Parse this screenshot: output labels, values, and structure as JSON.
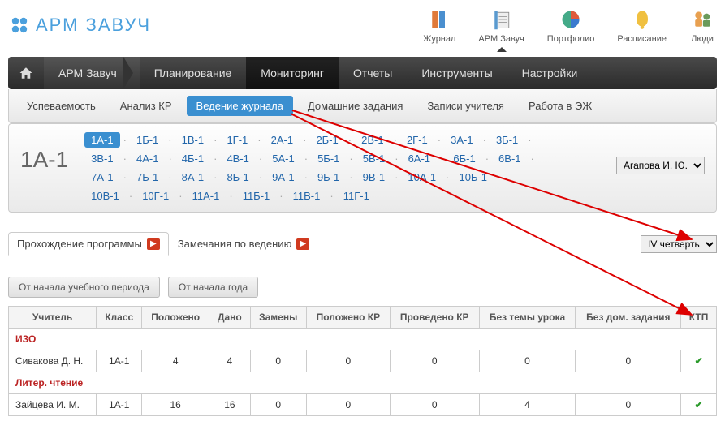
{
  "app": {
    "title": "АРМ ЗАВУЧ"
  },
  "topIcons": [
    {
      "label": "Журнал"
    },
    {
      "label": "АРМ Завуч",
      "active": true
    },
    {
      "label": "Портфолио"
    },
    {
      "label": "Расписание"
    },
    {
      "label": "Люди"
    }
  ],
  "mainNav": {
    "breadcrumb": "АРМ Завуч",
    "items": [
      "Планирование",
      "Мониторинг",
      "Отчеты",
      "Инструменты",
      "Настройки"
    ],
    "active": "Мониторинг"
  },
  "subNav": {
    "items": [
      "Успеваемость",
      "Анализ КР",
      "Ведение журнала",
      "Домашние задания",
      "Записи учителя",
      "Работа в ЭЖ"
    ],
    "active": "Ведение журнала"
  },
  "classSelector": {
    "current": "1А-1",
    "classes": [
      "1А-1",
      "1Б-1",
      "1В-1",
      "1Г-1",
      "2А-1",
      "2Б-1",
      "2В-1",
      "2Г-1",
      "3А-1",
      "3Б-1",
      "3В-1",
      "4А-1",
      "4Б-1",
      "4В-1",
      "5А-1",
      "5Б-1",
      "5В-1",
      "6А-1",
      "6Б-1",
      "6В-1",
      "7А-1",
      "7Б-1",
      "8А-1",
      "8Б-1",
      "9А-1",
      "9Б-1",
      "9В-1",
      "10А-1",
      "10Б-1",
      "10В-1",
      "10Г-1",
      "11А-1",
      "11Б-1",
      "11В-1",
      "11Г-1"
    ],
    "teacher": "Агапова И. Ю."
  },
  "tabs": {
    "items": [
      "Прохождение программы",
      "Замечания по ведению"
    ],
    "active": "Прохождение программы",
    "quarter": "IV четверть"
  },
  "filters": {
    "items": [
      "От начала учебного периода",
      "От начала года"
    ]
  },
  "table": {
    "headers": [
      "Учитель",
      "Класс",
      "Положено",
      "Дано",
      "Замены",
      "Положено КР",
      "Проведено КР",
      "Без темы урока",
      "Без дом. задания",
      "КТП"
    ],
    "groups": [
      {
        "subject": "ИЗО",
        "rows": [
          {
            "cells": [
              "Сивакова Д. Н.",
              "1А-1",
              "4",
              "4",
              "0",
              "0",
              "0",
              "0",
              "0",
              "✓"
            ]
          }
        ]
      },
      {
        "subject": "Литер. чтение",
        "rows": [
          {
            "cells": [
              "Зайцева И. М.",
              "1А-1",
              "16",
              "16",
              "0",
              "0",
              "0",
              "4",
              "0",
              "✓"
            ]
          }
        ]
      }
    ]
  }
}
